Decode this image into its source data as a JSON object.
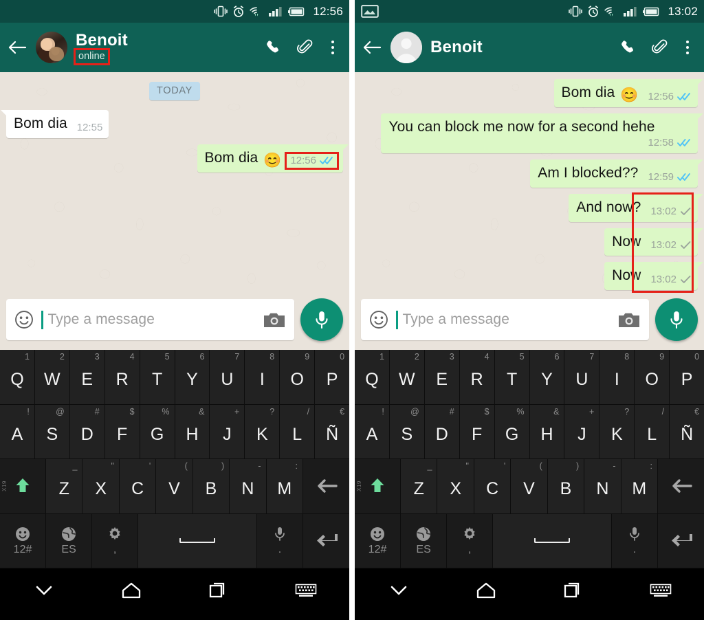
{
  "app": {
    "name": "WhatsApp",
    "platform": "Android"
  },
  "panels": [
    {
      "id": "left",
      "status_bar": {
        "clock": "12:56",
        "icons": [
          "vibrate-icon",
          "alarm-icon",
          "wifi-icon",
          "signal-icon",
          "battery-icon"
        ]
      },
      "app_bar": {
        "back_label": "Back",
        "avatar_type": "photo",
        "contact_name": "Benoit",
        "presence": "online",
        "presence_highlighted": true,
        "actions": [
          "call-icon",
          "attach-icon",
          "overflow-icon"
        ]
      },
      "chat": {
        "day_divider": "TODAY",
        "messages": [
          {
            "direction": "in",
            "text": "Bom dia",
            "emoji": "",
            "time": "12:55",
            "ticks": "none",
            "highlight": false
          },
          {
            "direction": "out",
            "text": "Bom dia",
            "emoji": "😊",
            "time": "12:56",
            "ticks": "double-blue",
            "highlight": true
          }
        ]
      },
      "composer": {
        "placeholder": "Type a message",
        "emoji_button": "smiley-icon",
        "camera_button": "camera-icon",
        "mic_button": "microphone-icon"
      }
    },
    {
      "id": "right",
      "status_bar": {
        "clock": "13:02",
        "icons": [
          "screenshot-icon",
          "vibrate-icon",
          "alarm-icon",
          "wifi-icon",
          "signal-icon",
          "battery-icon"
        ]
      },
      "app_bar": {
        "back_label": "Back",
        "avatar_type": "generic",
        "contact_name": "Benoit",
        "presence": "",
        "presence_highlighted": false,
        "actions": [
          "call-icon",
          "attach-icon",
          "overflow-icon"
        ]
      },
      "chat": {
        "day_divider": "",
        "messages": [
          {
            "direction": "out",
            "text": "Bom dia",
            "emoji": "😊",
            "time": "12:56",
            "ticks": "double-blue",
            "highlight": false
          },
          {
            "direction": "out",
            "text": "You can block me now for a second hehe",
            "emoji": "",
            "time": "12:58",
            "ticks": "double-blue",
            "highlight": false
          },
          {
            "direction": "out",
            "text": "Am I blocked??",
            "emoji": "",
            "time": "12:59",
            "ticks": "double-blue",
            "highlight": false
          },
          {
            "direction": "out",
            "text": "And now?",
            "emoji": "",
            "time": "13:02",
            "ticks": "single-gray",
            "highlight": true
          },
          {
            "direction": "out",
            "text": "Now",
            "emoji": "",
            "time": "13:02",
            "ticks": "single-gray",
            "highlight": true
          },
          {
            "direction": "out",
            "text": "Now",
            "emoji": "",
            "time": "13:02",
            "ticks": "single-gray",
            "highlight": true
          }
        ]
      },
      "composer": {
        "placeholder": "Type a message",
        "emoji_button": "smiley-icon",
        "camera_button": "camera-icon",
        "mic_button": "microphone-icon"
      }
    }
  ],
  "keyboard": {
    "layout": "ES QWERTY",
    "row1": [
      {
        "key": "Q",
        "hint": "1"
      },
      {
        "key": "W",
        "hint": "2"
      },
      {
        "key": "E",
        "hint": "3"
      },
      {
        "key": "R",
        "hint": "4"
      },
      {
        "key": "T",
        "hint": "5"
      },
      {
        "key": "Y",
        "hint": "6"
      },
      {
        "key": "U",
        "hint": "7"
      },
      {
        "key": "I",
        "hint": "8"
      },
      {
        "key": "O",
        "hint": "9"
      },
      {
        "key": "P",
        "hint": "0"
      }
    ],
    "row2": [
      {
        "key": "A",
        "hint": "!"
      },
      {
        "key": "S",
        "hint": "@"
      },
      {
        "key": "D",
        "hint": "#"
      },
      {
        "key": "F",
        "hint": "$"
      },
      {
        "key": "G",
        "hint": "%"
      },
      {
        "key": "H",
        "hint": "&"
      },
      {
        "key": "J",
        "hint": "+"
      },
      {
        "key": "K",
        "hint": "?"
      },
      {
        "key": "L",
        "hint": "/"
      },
      {
        "key": "Ñ",
        "hint": "€"
      }
    ],
    "row3": [
      {
        "key": "Z",
        "hint": "_"
      },
      {
        "key": "X",
        "hint": "\""
      },
      {
        "key": "C",
        "hint": "'"
      },
      {
        "key": "V",
        "hint": "("
      },
      {
        "key": "B",
        "hint": ")"
      },
      {
        "key": "N",
        "hint": "-"
      },
      {
        "key": "M",
        "hint": ":"
      }
    ],
    "shift_key": {
      "name": "shift-key",
      "side_tag": "X19"
    },
    "backspace_key": {
      "name": "backspace-key"
    },
    "row4": {
      "emoji_key": {
        "icon": "smiley-icon",
        "label": "12#"
      },
      "language_key": {
        "icon": "globe-icon",
        "label": "ES"
      },
      "settings_key": {
        "icon": "gear-icon",
        "label": ","
      },
      "space_key": {
        "label": ""
      },
      "mic_key": {
        "icon": "microphone-icon",
        "label": "."
      },
      "enter_key": {
        "icon": "enter-icon",
        "label": ""
      }
    }
  },
  "nav_bar": {
    "buttons": [
      "collapse-keyboard-icon",
      "home-icon",
      "recents-icon",
      "keyboard-switch-icon"
    ]
  },
  "colors": {
    "status_bar": "#0c4a42",
    "app_bar": "#0f6155",
    "chat_background": "#e9e3db",
    "outgoing_bubble": "#dcf8c6",
    "incoming_bubble": "#ffffff",
    "day_chip": "#bfdced",
    "highlight_box": "#e52119",
    "read_tick_blue": "#4fc3f7",
    "sent_tick_gray": "#9aa39b",
    "mic_button": "#0d8f73",
    "keyboard_bg": "#222222",
    "shift_arrow": "#6ddc9c"
  }
}
